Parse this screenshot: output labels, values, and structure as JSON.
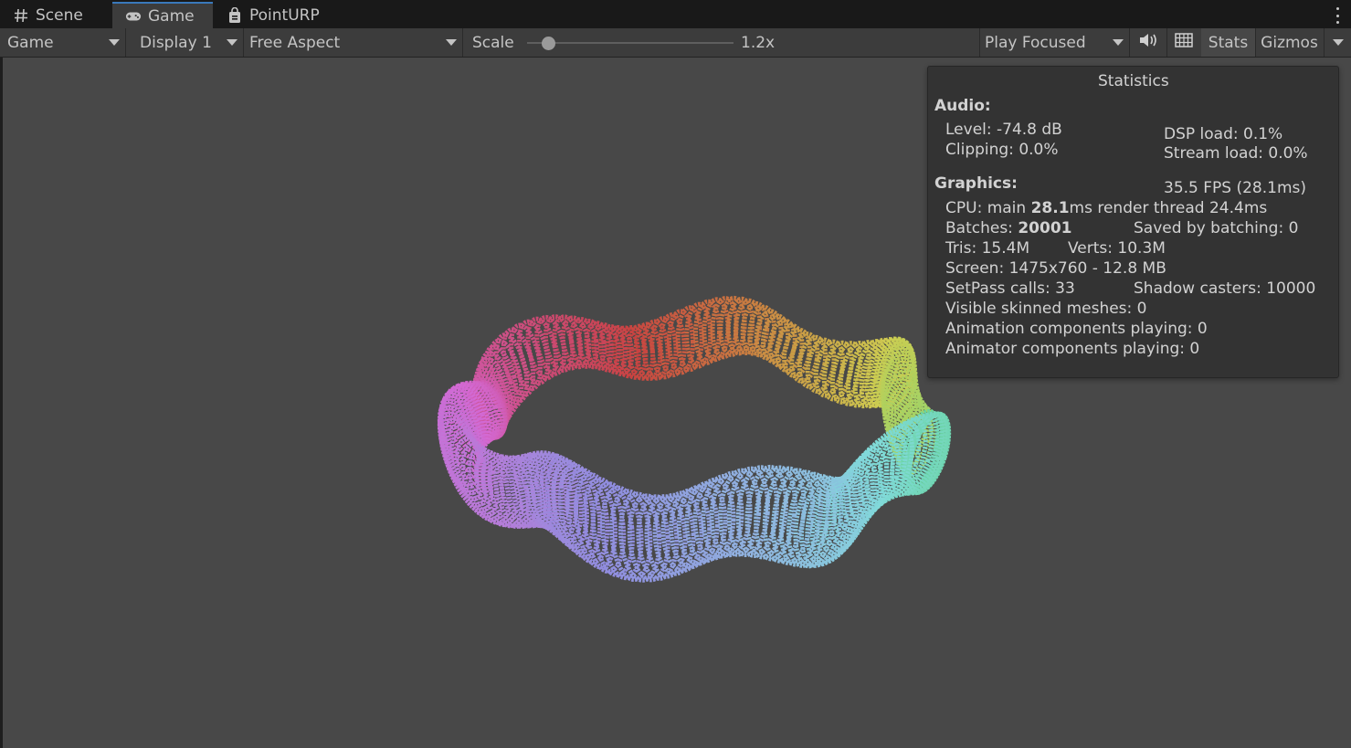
{
  "tabs": [
    {
      "label": "Scene",
      "icon": "hash-icon"
    },
    {
      "label": "Game",
      "icon": "gamepad-icon"
    },
    {
      "label": "PointURP",
      "icon": "lock-document-icon"
    }
  ],
  "toolbar": {
    "view_select": "Game",
    "display_select": "Display 1",
    "aspect_select": "Free Aspect",
    "scale_label": "Scale",
    "scale_value": "1.2x",
    "scale_fraction": 0.1,
    "play_mode_select": "Play Focused",
    "stats_label": "Stats",
    "gizmos_label": "Gizmos"
  },
  "statistics": {
    "title": "Statistics",
    "audio_heading": "Audio:",
    "level": "Level: -74.8 dB",
    "clipping": "Clipping: 0.0%",
    "dsp_load": "DSP load: 0.1%",
    "stream_load": "Stream load: 0.0%",
    "graphics_heading": "Graphics:",
    "fps": "35.5 FPS (28.1ms)",
    "cpu_prefix": "CPU: main ",
    "cpu_main": "28.1",
    "cpu_suffix": "ms  render thread 24.4ms",
    "batches_prefix": "Batches: ",
    "batches": "20001",
    "saved_by_batching": "Saved by batching: 0",
    "tris": "Tris: 15.4M",
    "verts": "Verts: 10.3M",
    "screen": "Screen: 1475x760 - 12.8 MB",
    "setpass": "SetPass calls: 33",
    "shadow_casters": "Shadow casters: 10000",
    "skinned_meshes": "Visible skinned meshes: 0",
    "animation_components": "Animation components playing: 0",
    "animator_components": "Animator components playing: 0"
  },
  "colors": {
    "accent": "#3a79bb",
    "viewport": "#484848",
    "toolbar": "#3c3c3c"
  }
}
